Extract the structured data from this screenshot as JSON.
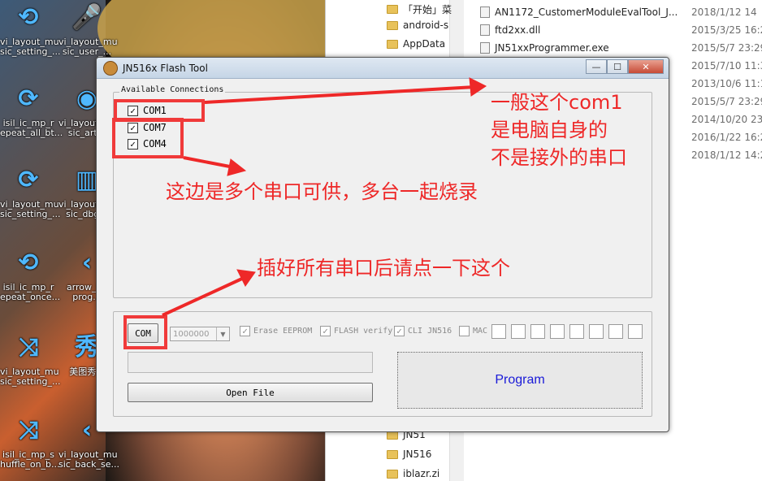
{
  "desktop": {
    "icons": [
      {
        "label": "vi_layout_mu sic_setting_...",
        "icon": "repeat-one-icon"
      },
      {
        "label": "vi_layout_mu sic_user_...",
        "icon": "microphone-icon"
      },
      {
        "label": "isil_ic_mp_r epeat_all_bt...",
        "icon": "repeat-icon"
      },
      {
        "label": "vi_layout_mu sic_art...",
        "icon": "disc-icon"
      },
      {
        "label": "vi_layout_mu sic_setting_...",
        "icon": "repeat-icon"
      },
      {
        "label": "vi_layout_mu sic_dbg...",
        "icon": "building-icon"
      },
      {
        "label": "isil_ic_mp_r epeat_once...",
        "icon": "repeat-one-icon"
      },
      {
        "label": "arrow_l... prog...",
        "icon": "arrow-left-icon"
      },
      {
        "label": "vi_layout_mu sic_setting_...",
        "icon": "shuffle-icon"
      },
      {
        "label": "美图秀...",
        "icon": "meitu-icon"
      },
      {
        "label": "isil_ic_mp_s huffle_on_b...",
        "icon": "shuffle-icon"
      },
      {
        "label": "vi_layout_mu sic_back_se...",
        "icon": "arrow-left-icon"
      }
    ]
  },
  "explorer": {
    "nav": [
      "「开始」菜",
      "android-s",
      "AppData",
      "JN51",
      "JN516",
      "iblazr.zi"
    ],
    "files": [
      {
        "name": "AN1172_CustomerModuleEvalTool_J...",
        "date": "2018/1/12 14"
      },
      {
        "name": "ftd2xx.dll",
        "date": "2015/3/25 16:29"
      },
      {
        "name": "JN51xxProgrammer.exe",
        "date": "2015/5/7 23:29"
      },
      {
        "name": "",
        "date": "2015/7/10 11:3"
      },
      {
        "name": "",
        "date": "2013/10/6 11:17"
      },
      {
        "name": "",
        "date": "2015/5/7 23:29"
      },
      {
        "name": "",
        "date": "2014/10/20 23:"
      },
      {
        "name": "",
        "date": "2016/1/22 16:2"
      },
      {
        "name": "",
        "date": "2018/1/12 14:2"
      }
    ]
  },
  "window": {
    "title": "JN516x Flash Tool",
    "minimize": "—",
    "maximize": "☐",
    "close": "✕",
    "connections_label": "Available Connections",
    "connections": [
      {
        "label": "COM1",
        "checked": "✓"
      },
      {
        "label": "COM7",
        "checked": "✓"
      },
      {
        "label": "COM4",
        "checked": "✓"
      }
    ],
    "com_button": "COM",
    "baud": "1000000",
    "options": [
      {
        "label": "Erase EEPROM",
        "checked": "✓"
      },
      {
        "label": "FLASH verify",
        "checked": "✓"
      },
      {
        "label": "CLI JN516",
        "checked": "✓"
      },
      {
        "label": "MAC",
        "checked": ""
      }
    ],
    "open_file": "Open File",
    "program": "Program"
  },
  "annotations": {
    "com1_note_1": "一般这个com1",
    "com1_note_2": "是电脑自身的",
    "com1_note_3": "不是接外的串口",
    "multi_ports": "这边是多个串口可供，多台一起烧录",
    "com_button_note": "插好所有串口后请点一下这个"
  },
  "colors": {
    "annotation_red": "#ee2828",
    "program_text": "#1a1ad8"
  }
}
